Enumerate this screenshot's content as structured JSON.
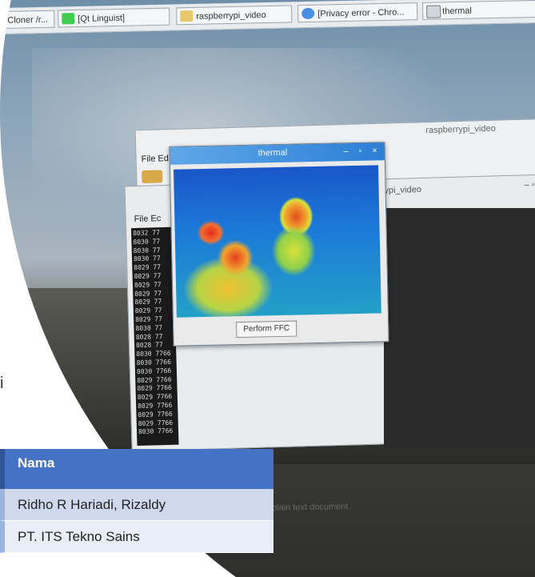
{
  "taskbar": {
    "items": [
      {
        "label": "Cloner /r..."
      },
      {
        "label": "[Qt Linguist]"
      },
      {
        "label": "raspberrypi_video"
      },
      {
        "label": "[Privacy error - Chro..."
      },
      {
        "label": "thermal"
      }
    ]
  },
  "back_window": {
    "title": "raspberrypi_video",
    "menu": "File  Ed"
  },
  "mid_window": {
    "title": "rypi_video",
    "controls": "–  ▫",
    "menu": "File  Ec",
    "terminal_lines": "8032 77\n8030 77\n8030 77\n8030 77\n8029 77\n8029 77\n8029 77\n8029 77\n8029 77\n8029 77\n8029 77\n8030 77\n8028 77\n8028 77\n8030 7766\n8030 7766\n8030 7766\n8029 7766\n8029 7766\n8029 7766\n8029 7766\n8029 7766\n8029 7766\n8030 7766"
  },
  "thermal_window": {
    "title": "thermal",
    "minimize": "–",
    "maximize": "▫",
    "close": "×",
    "button": "Perform FFC"
  },
  "status_doc": "plain text document",
  "left_text": "i",
  "table": {
    "header": "Nama",
    "rows": [
      "Ridho R Hariadi, Rizaldy",
      "PT. ITS Tekno Sains"
    ]
  },
  "colors": {
    "header_blue": "#4472c4",
    "row1": "#cfd9ee",
    "row2": "#e8edf7",
    "titlebar": "#2c7fd6"
  }
}
